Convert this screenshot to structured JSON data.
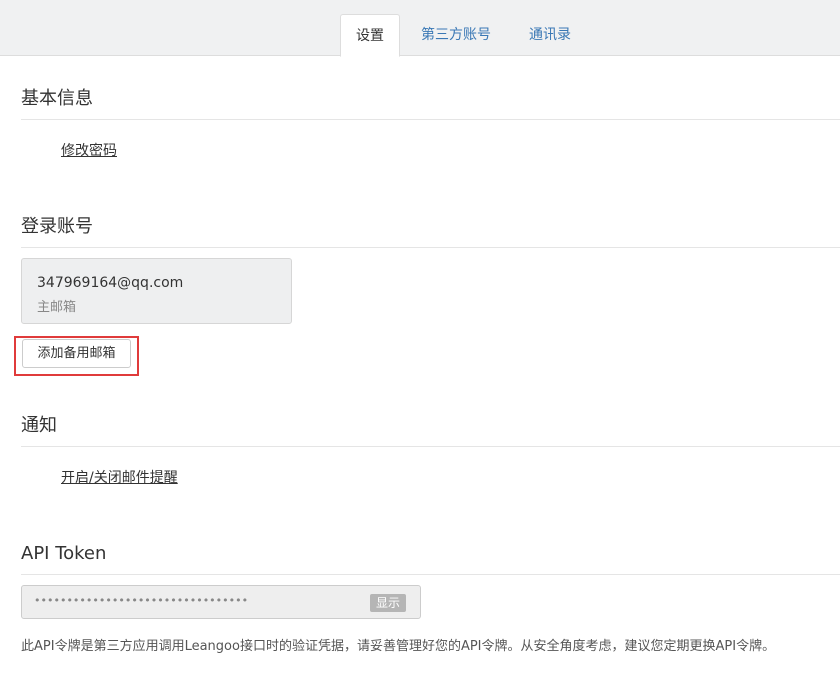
{
  "tabs": [
    {
      "label": "设置",
      "active": true
    },
    {
      "label": "第三方账号",
      "active": false
    },
    {
      "label": "通讯录",
      "active": false
    }
  ],
  "basic_info": {
    "title": "基本信息",
    "change_password": "修改密码"
  },
  "login_account": {
    "title": "登录账号",
    "email": "347969164@qq.com",
    "email_type": "主邮箱",
    "add_backup_button": "添加备用邮箱"
  },
  "notification": {
    "title": "通知",
    "toggle_email": "开启/关闭邮件提醒"
  },
  "api_token": {
    "title": "API Token",
    "masked_value": "•••••••••••••••••••••••••••••••••",
    "show_button": "显示",
    "note": "此API令牌是第三方应用调用Leangoo接口时的验证凭据，请妥善管理好您的API令牌。从安全角度考虑，建议您定期更换API令牌。"
  },
  "colors": {
    "link": "#3a78b5",
    "highlight": "#e03b3b"
  }
}
